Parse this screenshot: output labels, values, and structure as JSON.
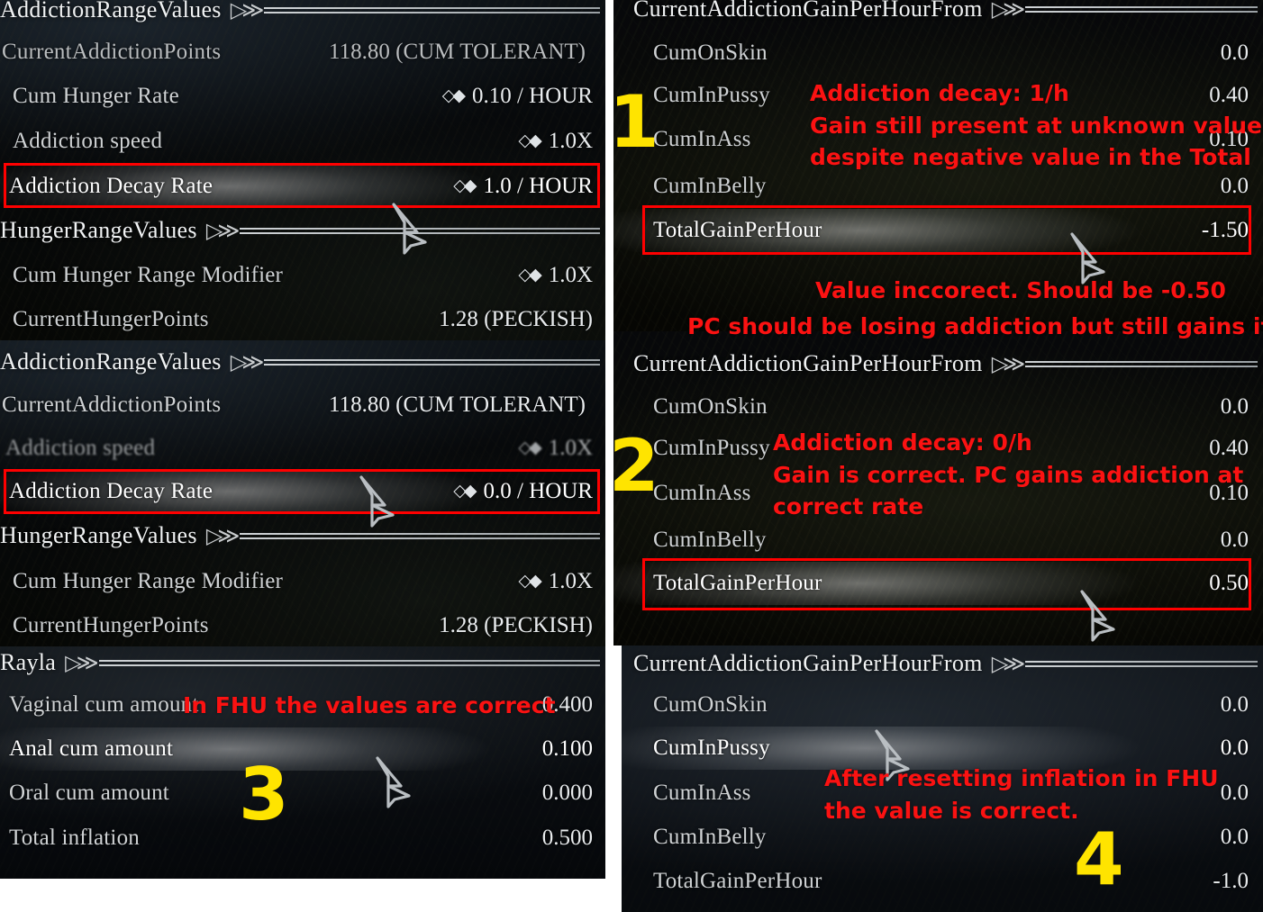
{
  "meta": {
    "accent_red": "#ff0000",
    "accent_yellow": "#ffe400",
    "glyph_double_chevron": "▷≫",
    "glyph_stepper": "◇◆"
  },
  "panels": {
    "left_top": {
      "sections": [
        {
          "header": "AddictionRangeValues",
          "rows": [
            {
              "label": "CurrentAddictionPoints",
              "value": "118.80 (CUM TOLERANT)",
              "stepper": false
            },
            {
              "label": "Cum Hunger Rate",
              "value": "0.10 / HOUR",
              "stepper": true
            },
            {
              "label": "Addiction speed",
              "value": "1.0X",
              "stepper": true
            },
            {
              "label": "Addiction Decay Rate",
              "value": "1.0 / HOUR",
              "stepper": true,
              "selected": true,
              "highlighted": true
            }
          ]
        },
        {
          "header": "HungerRangeValues",
          "rows": [
            {
              "label": "Cum Hunger Range Modifier",
              "value": "1.0X",
              "stepper": true
            },
            {
              "label": "CurrentHungerPoints",
              "value": "1.28 (PECKISH)",
              "stepper": false
            }
          ]
        }
      ]
    },
    "left_mid": {
      "sections": [
        {
          "header": "AddictionRangeValues",
          "rows": [
            {
              "label": "CurrentAddictionPoints",
              "value": "118.80 (CUM TOLERANT)",
              "stepper": false
            },
            {
              "label": "Addiction speed",
              "value": "1.0X",
              "stepper": true,
              "smeared": true
            },
            {
              "label": "Addiction Decay Rate",
              "value": "0.0 / HOUR",
              "stepper": true,
              "selected": true,
              "highlighted": true
            }
          ]
        },
        {
          "header": "HungerRangeValues",
          "rows": [
            {
              "label": "Cum Hunger Range Modifier",
              "value": "1.0X",
              "stepper": true
            },
            {
              "label": "CurrentHungerPoints",
              "value": "1.28 (PECKISH)",
              "stepper": false
            }
          ]
        }
      ]
    },
    "left_bottom": {
      "sections": [
        {
          "header": "Rayla",
          "rows": [
            {
              "label": "Vaginal cum amount",
              "value": "0.400",
              "stepper": false
            },
            {
              "label": "Anal cum amount",
              "value": "0.100",
              "stepper": false,
              "selected": true
            },
            {
              "label": "Oral cum amount",
              "value": "0.000",
              "stepper": false
            },
            {
              "label": "Total inflation",
              "value": "0.500",
              "stepper": false
            }
          ]
        }
      ]
    },
    "right_top": {
      "header": "CurrentAddictionGainPerHourFrom",
      "rows": [
        {
          "label": "CumOnSkin",
          "value": "0.0"
        },
        {
          "label": "CumInPussy",
          "value": "0.40"
        },
        {
          "label": "CumInAss",
          "value": "0.10"
        },
        {
          "label": "CumInBelly",
          "value": "0.0"
        },
        {
          "label": "TotalGainPerHour",
          "value": "-1.50",
          "selected": true,
          "highlighted": true
        }
      ]
    },
    "right_mid": {
      "header": "CurrentAddictionGainPerHourFrom",
      "rows": [
        {
          "label": "CumOnSkin",
          "value": "0.0"
        },
        {
          "label": "CumInPussy",
          "value": "0.40"
        },
        {
          "label": "CumInAss",
          "value": "0.10"
        },
        {
          "label": "CumInBelly",
          "value": "0.0"
        },
        {
          "label": "TotalGainPerHour",
          "value": "0.50",
          "selected": true,
          "highlighted": true
        }
      ]
    },
    "right_bottom": {
      "header": "CurrentAddictionGainPerHourFrom",
      "rows": [
        {
          "label": "CumOnSkin",
          "value": "0.0"
        },
        {
          "label": "CumInPussy",
          "value": "0.0",
          "selected": true
        },
        {
          "label": "CumInAss",
          "value": "0.0"
        },
        {
          "label": "CumInBelly",
          "value": "0.0"
        },
        {
          "label": "TotalGainPerHour",
          "value": "-1.0"
        }
      ]
    }
  },
  "annotations": {
    "n1": "1",
    "n2": "2",
    "n3": "3",
    "n4": "4",
    "a1": "Addiction decay: 1/h\nGain still present at unknown value\ndespite negative value in the Total",
    "a2": "Value inccorect. Should be -0.50",
    "a3": "PC should be losing addiction but still gains it",
    "a4": "Addiction decay: 0/h\nGain is correct. PC gains addiction at\ncorrect rate",
    "a5": "After resetting inflation in FHU\nthe value is correct.",
    "a6": "In FHU the values are correct"
  }
}
